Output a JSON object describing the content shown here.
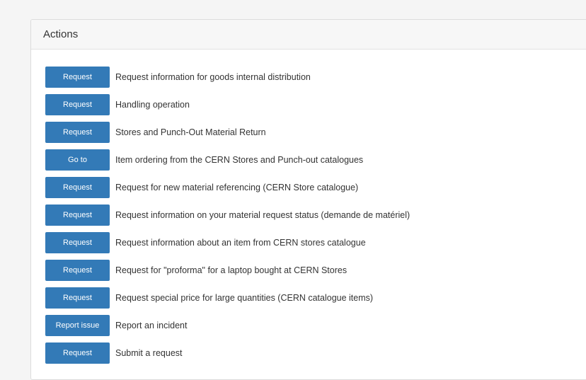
{
  "panel": {
    "title": "Actions"
  },
  "actions": [
    {
      "button": "Request",
      "label": "Request information for goods internal distribution"
    },
    {
      "button": "Request",
      "label": "Handling operation"
    },
    {
      "button": "Request",
      "label": "Stores and Punch-Out Material Return"
    },
    {
      "button": "Go to",
      "label": "Item ordering from the CERN Stores and Punch-out catalogues"
    },
    {
      "button": "Request",
      "label": "Request for new material referencing (CERN Store catalogue)"
    },
    {
      "button": "Request",
      "label": "Request information on your material request status (demande de matériel)"
    },
    {
      "button": "Request",
      "label": "Request information about an item from CERN stores catalogue"
    },
    {
      "button": "Request",
      "label": "Request for \"proforma\" for a laptop bought at CERN Stores"
    },
    {
      "button": "Request",
      "label": "Request special price for large quantities (CERN catalogue items)"
    },
    {
      "button": "Report issue",
      "label": "Report an incident"
    },
    {
      "button": "Request",
      "label": "Submit a request"
    }
  ],
  "colors": {
    "button_bg": "#337ab7",
    "button_text": "#ffffff",
    "label_text": "#333333",
    "header_bg": "#f7f7f7"
  }
}
